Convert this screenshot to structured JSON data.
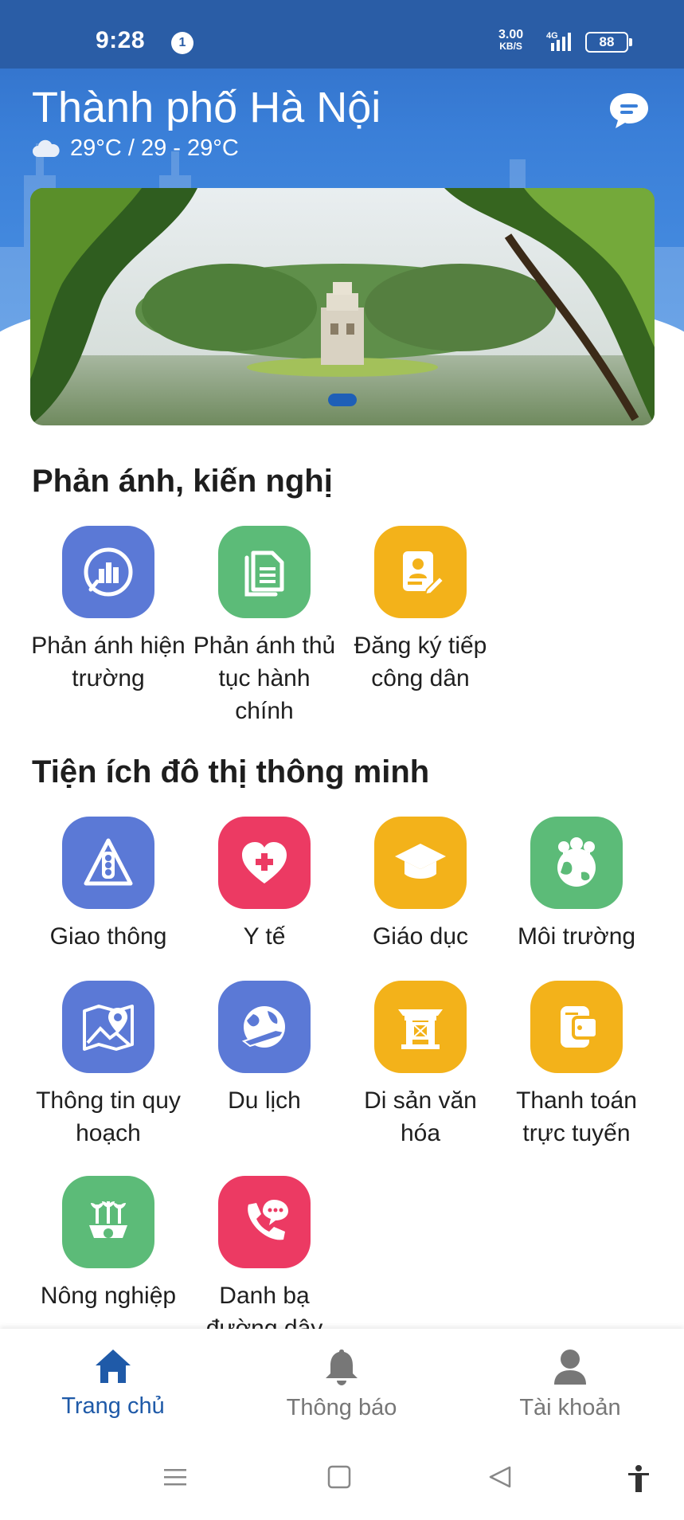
{
  "status_bar": {
    "time": "9:28",
    "notification_count": "1",
    "speed_value": "3.00",
    "speed_unit": "KB/S",
    "network": "4G",
    "battery": "88"
  },
  "header": {
    "city": "Thành phố Hà Nội",
    "weather": "29°C / 29 - 29°C"
  },
  "sections": {
    "feedback": {
      "title": "Phản ánh, kiến nghị",
      "items": [
        {
          "label": "Phản ánh hiện trường",
          "icon": "city-report-icon",
          "color": "#5b79d6"
        },
        {
          "label": "Phản ánh thủ tục hành chính",
          "icon": "document-icon",
          "color": "#5cbb78"
        },
        {
          "label": "Đăng ký tiếp công dân",
          "icon": "citizen-registration-icon",
          "color": "#f3b21a"
        }
      ]
    },
    "smart_city": {
      "title": "Tiện ích đô thị thông minh",
      "items": [
        {
          "label": "Giao thông",
          "icon": "traffic-light-icon",
          "color": "#5b79d6"
        },
        {
          "label": "Y tế",
          "icon": "heart-health-icon",
          "color": "#ec3a63"
        },
        {
          "label": "Giáo dục",
          "icon": "graduation-cap-icon",
          "color": "#f3b21a"
        },
        {
          "label": "Môi trường",
          "icon": "earth-trees-icon",
          "color": "#5cbb78"
        },
        {
          "label": "Thông tin quy hoạch",
          "icon": "map-pin-icon",
          "color": "#5b79d6"
        },
        {
          "label": "Du lịch",
          "icon": "globe-plane-icon",
          "color": "#5b79d6"
        },
        {
          "label": "Di sản văn hóa",
          "icon": "heritage-gate-icon",
          "color": "#f3b21a"
        },
        {
          "label": "Thanh toán trực tuyến",
          "icon": "wallet-icon",
          "color": "#f3b21a"
        },
        {
          "label": "Nông nghiệp",
          "icon": "agriculture-icon",
          "color": "#5cbb78"
        },
        {
          "label": "Danh bạ đường dây",
          "icon": "phone-chat-icon",
          "color": "#ec3a63"
        }
      ]
    }
  },
  "bottom_nav": {
    "home": "Trang chủ",
    "notifications": "Thông báo",
    "account": "Tài khoản"
  }
}
